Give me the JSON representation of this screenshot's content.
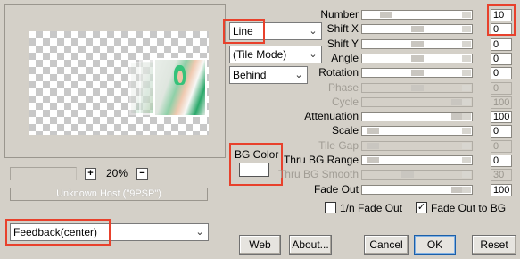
{
  "preview": {
    "zoom_value": "20%",
    "zoom_in": "+",
    "zoom_out": "−",
    "host_text": "Unknown Host (\"9PSP\")"
  },
  "preset_select": {
    "value": "Feedback(center)"
  },
  "mode_selects": {
    "shape": "Line",
    "tile": "(Tile Mode)",
    "blend": "Behind"
  },
  "bg_color": {
    "label": "BG Color",
    "swatch": "#ffffff"
  },
  "params": [
    {
      "label": "Number",
      "value": "10",
      "enabled": true,
      "thumb": 0.18
    },
    {
      "label": "Shift X",
      "value": "0",
      "enabled": true,
      "thumb": 0.5
    },
    {
      "label": "Shift Y",
      "value": "0",
      "enabled": true,
      "thumb": 0.5
    },
    {
      "label": "Angle",
      "value": "0",
      "enabled": true,
      "thumb": 0.5
    },
    {
      "label": "Rotation",
      "value": "0",
      "enabled": true,
      "thumb": 0.5
    },
    {
      "label": "Phase",
      "value": "0",
      "enabled": false,
      "thumb": 0.5
    },
    {
      "label": "Cycle",
      "value": "100",
      "enabled": false,
      "thumb": 0.92
    },
    {
      "label": "Attenuation",
      "value": "100",
      "enabled": true,
      "thumb": 0.92
    },
    {
      "label": "Scale",
      "value": "0",
      "enabled": true,
      "thumb": 0.05
    },
    {
      "label": "Tile Gap",
      "value": "0",
      "enabled": false,
      "thumb": 0.05
    },
    {
      "label": "Thru BG Range",
      "value": "0",
      "enabled": true,
      "thumb": 0.05
    },
    {
      "label": "Thru BG Smooth",
      "value": "30",
      "enabled": false,
      "thumb": 0.4
    },
    {
      "label": "Fade Out",
      "value": "100",
      "enabled": true,
      "thumb": 0.92
    }
  ],
  "options": {
    "fade_out_1n": {
      "label": "1/n Fade Out",
      "checked": false
    },
    "fade_out_bg": {
      "label": "Fade Out to BG",
      "checked": true
    }
  },
  "buttons": {
    "web": "Web",
    "about": "About...",
    "cancel": "Cancel",
    "ok": "OK",
    "reset": "Reset"
  },
  "colors": {
    "highlight": "#e8412c",
    "dialog_bg": "#d4d0c8"
  }
}
